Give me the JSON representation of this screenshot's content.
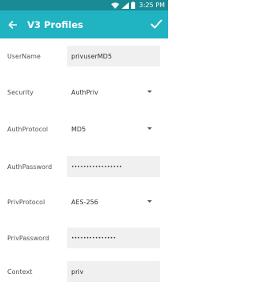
{
  "status_bar": {
    "time": "3:25 PM",
    "icons": [
      "wifi-icon",
      "signal-icon",
      "battery-icon"
    ]
  },
  "app_bar": {
    "title": "V3 Profiles",
    "back_icon": "arrow-left-icon",
    "confirm_icon": "checkmark-icon"
  },
  "colors": {
    "status_bar": "#1a8a95",
    "app_bar": "#20b3c2",
    "field_bg": "#f0f0f0"
  },
  "form": {
    "username": {
      "label": "UserName",
      "value": "privuserMD5"
    },
    "security": {
      "label": "Security",
      "value": "AuthPriv"
    },
    "auth_protocol": {
      "label": "AuthProtocol",
      "value": "MD5"
    },
    "auth_password": {
      "label": "AuthPassword",
      "value": "•••••••••••••••••"
    },
    "priv_protocol": {
      "label": "PrivProtocol",
      "value": "AES-256"
    },
    "priv_password": {
      "label": "PrivPassword",
      "value": "•••••••••••••••"
    },
    "context": {
      "label": "Context",
      "value": "priv"
    }
  }
}
